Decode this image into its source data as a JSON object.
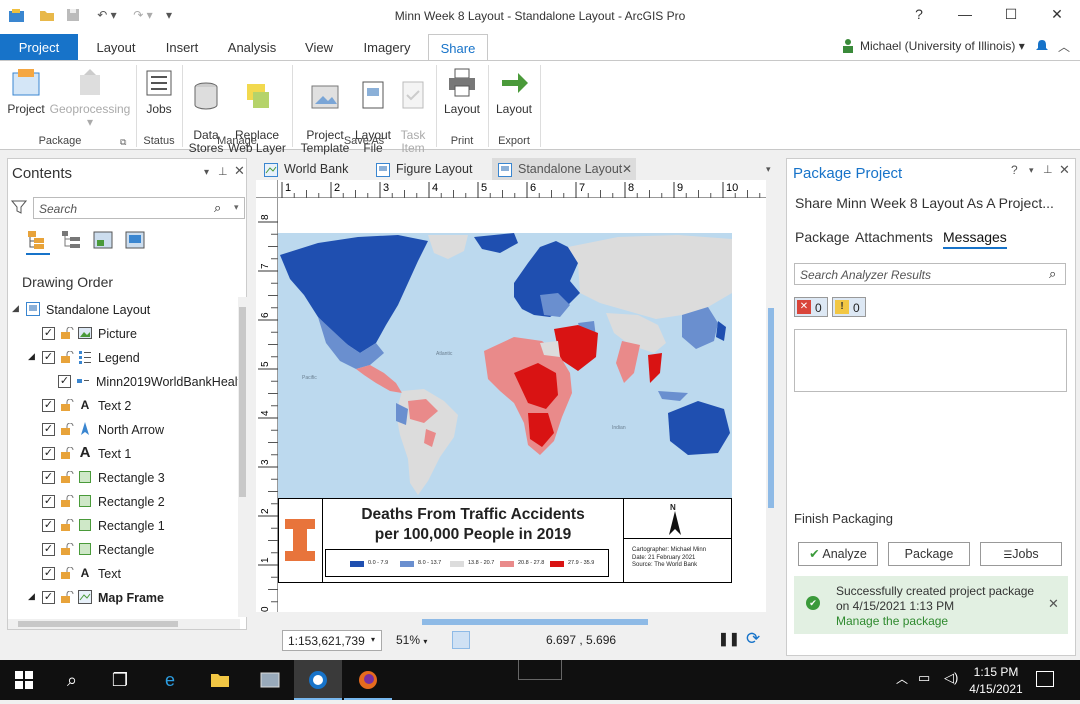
{
  "window": {
    "title": "Minn Week 8 Layout - Standalone Layout - ArcGIS Pro",
    "help": "?",
    "minimize": "—",
    "maximize": "☐",
    "close": "✕"
  },
  "ribbon_tabs": [
    "Project",
    "Layout",
    "Insert",
    "Analysis",
    "View",
    "Imagery",
    "Share"
  ],
  "user": "Michael (University of Illinois)",
  "ribbon": {
    "package": {
      "project": "Project",
      "geoprocessing": "Geoprocessing",
      "group": "Package"
    },
    "status": {
      "jobs": "Jobs",
      "group": "Status"
    },
    "manage": {
      "data_stores": "Data\nStores",
      "replace": "Replace\nWeb Layer",
      "group": "Manage"
    },
    "save_as": {
      "project_template": "Project\nTemplate",
      "layout_file": "Layout\nFile",
      "task_item": "Task\nItem",
      "group": "Save As"
    },
    "print": {
      "layout": "Layout",
      "group": "Print"
    },
    "export": {
      "layout": "Layout",
      "group": "Export"
    }
  },
  "contents": {
    "title": "Contents",
    "search_placeholder": "Search",
    "drawing_order": "Drawing Order",
    "root": "Standalone Layout",
    "items": [
      {
        "label": "Picture",
        "icon": "picture-icon"
      },
      {
        "label": "Legend",
        "icon": "legend-icon"
      },
      {
        "label": "Minn2019WorldBankHealtl",
        "icon": "legend-item-icon"
      },
      {
        "label": "Text 2",
        "icon": "text-icon"
      },
      {
        "label": "North Arrow",
        "icon": "north-arrow-icon"
      },
      {
        "label": "Text 1",
        "icon": "text-icon"
      },
      {
        "label": "Rectangle 3",
        "icon": "rectangle-icon"
      },
      {
        "label": "Rectangle 2",
        "icon": "rectangle-icon"
      },
      {
        "label": "Rectangle 1",
        "icon": "rectangle-icon"
      },
      {
        "label": "Rectangle",
        "icon": "rectangle-icon"
      },
      {
        "label": "Text",
        "icon": "text-icon"
      },
      {
        "label": "Map Frame",
        "icon": "map-frame-icon"
      }
    ]
  },
  "view_tabs": [
    "World Bank",
    "Figure Layout",
    "Standalone Layout"
  ],
  "ruler_h": [
    "1",
    "2",
    "3",
    "4",
    "5",
    "6",
    "7",
    "8",
    "9",
    "10"
  ],
  "ruler_v": [
    "8",
    "7",
    "6",
    "5",
    "4",
    "3",
    "2",
    "1",
    "0"
  ],
  "layout": {
    "title_line1": "Deaths From Traffic Accidents",
    "title_line2": "per 100,000 People in 2019",
    "legend": [
      "0.0 - 7.9",
      "8.0 - 13.7",
      "13.8 - 20.7",
      "20.8 - 27.8",
      "27.9 - 35.9"
    ],
    "legend_colors": [
      "#1f4fb0",
      "#6a8fcf",
      "#dcdcdc",
      "#e98a8a",
      "#d91313"
    ],
    "credit": [
      "Cartographer: Michael Minn",
      "Date: 21 February 2021",
      "Source: The World Bank"
    ],
    "north": "N",
    "ocean_atlantic": "Atlantic\nOcean",
    "ocean_pacific": "Pacific\nOcean",
    "ocean_indian": "Indian\nOcean"
  },
  "status": {
    "scale": "1:153,621,739",
    "zoom": "51%",
    "coords": "6.697 , 5.696"
  },
  "package_pane": {
    "title": "Package Project",
    "subtitle": "Share Minn Week 8 Layout As A Project...",
    "tabs": [
      "Package",
      "Attachments",
      "Messages"
    ],
    "search_placeholder": "Search Analyzer Results",
    "errors": "0",
    "warnings": "0",
    "finish": "Finish Packaging",
    "analyze": "Analyze",
    "package": "Package",
    "jobs": "Jobs",
    "success_line1": "Successfully created project package",
    "success_line2": "on 4/15/2021 1:13 PM",
    "manage_link": "Manage the package"
  },
  "taskbar": {
    "time": "1:15 PM",
    "date": "4/15/2021"
  }
}
